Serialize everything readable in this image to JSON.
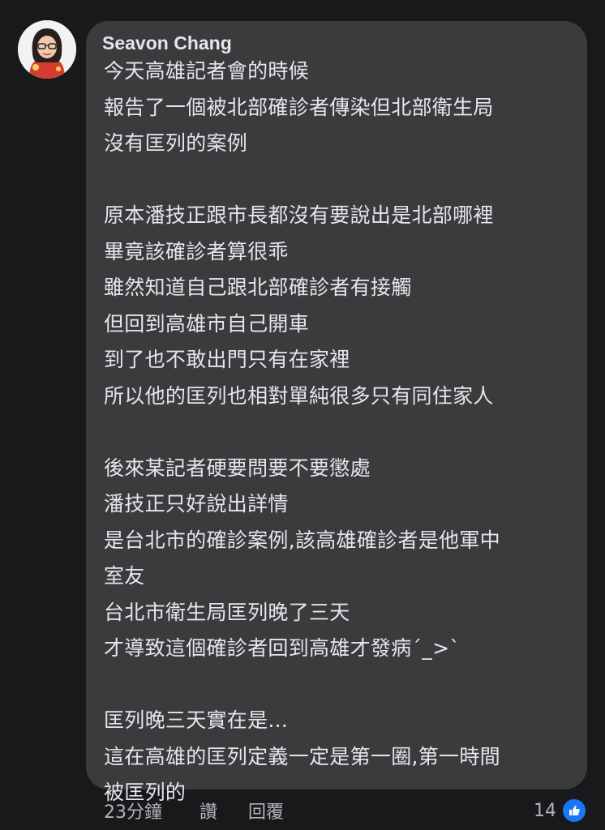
{
  "comment": {
    "author": "Seavon Chang",
    "lines": [
      "今天高雄記者會的時候",
      "報告了一個被北部確診者傳染但北部衛生局",
      "沒有匡列的案例",
      "",
      "原本潘技正跟市長都沒有要說出是北部哪裡",
      "畢竟該確診者算很乖",
      "雖然知道自己跟北部確診者有接觸",
      "但回到高雄市自己開車",
      "到了也不敢出門只有在家裡",
      "所以他的匡列也相對單純很多只有同住家人",
      "",
      "後來某記者硬要問要不要懲處",
      "潘技正只好說出詳情",
      "是台北市的確診案例,該高雄確診者是他軍中",
      "室友",
      "台北市衛生局匡列晚了三天",
      "才導致這個確診者回到高雄才發病´_>`",
      "",
      "匡列晚三天實在是...",
      "這在高雄的匡列定義一定是第一圈,第一時間",
      "被匡列的"
    ]
  },
  "actions": {
    "time": "23分鐘",
    "like": "讚",
    "reply": "回覆"
  },
  "reactions": {
    "count": "14",
    "icon": "thumbs-up-icon",
    "color": "#1877f2"
  }
}
